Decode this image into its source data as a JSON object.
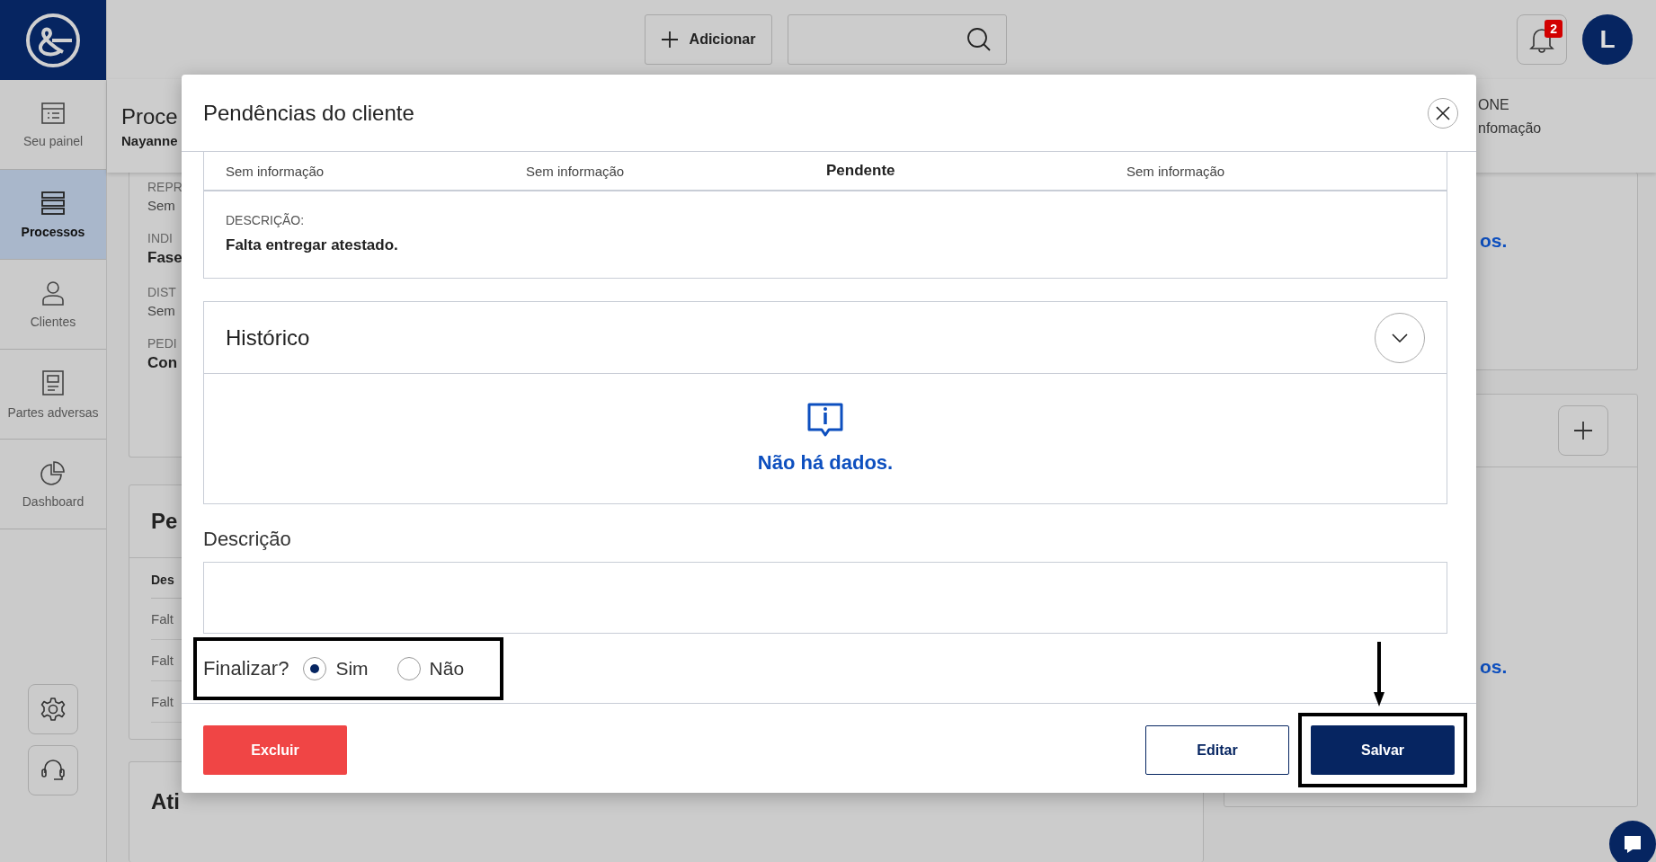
{
  "sidebar": {
    "items": [
      {
        "label": "Seu painel",
        "selected": false
      },
      {
        "label": "Processos",
        "selected": true
      },
      {
        "label": "Clientes",
        "selected": false
      },
      {
        "label": "Partes adversas",
        "selected": false
      },
      {
        "label": "Dashboard",
        "selected": false
      }
    ]
  },
  "topbar": {
    "add_button": "Adicionar",
    "notification_count": "2",
    "avatar_initial": "L"
  },
  "background": {
    "header": {
      "title": "Proce",
      "subtitle": "Nayanne",
      "right_label": "ONE",
      "right_value": "nfomação"
    },
    "details": [
      {
        "label": "REPR",
        "value": "Sem",
        "kind": "plain"
      },
      {
        "label": "INDI",
        "value": "Fase",
        "kind": "strong"
      },
      {
        "label": "DIST",
        "value": "Sem",
        "kind": "plain"
      },
      {
        "label": "PEDI",
        "value": "Con",
        "kind": "strong"
      }
    ],
    "pending_card": {
      "title": "Pe",
      "column": "Des",
      "rows": [
        "Falt",
        "Falt",
        "Falt"
      ]
    },
    "activities_card": {
      "title": "Ati"
    },
    "right_cards": [
      {
        "text": "os.",
        "kind": "plain"
      },
      {
        "text": "os.",
        "kind": "with_add"
      }
    ]
  },
  "modal": {
    "title": "Pendências do cliente",
    "summary": [
      {
        "text": "Sem informação",
        "kind": "plain"
      },
      {
        "text": "Sem informação",
        "kind": "plain"
      },
      {
        "text": "Pendente",
        "kind": "status"
      },
      {
        "text": "Sem informação",
        "kind": "plain"
      }
    ],
    "description": {
      "label": "DESCRIÇÃO:",
      "text": "Falta entregar atestado."
    },
    "history": {
      "title": "Histórico",
      "empty_text": "Não há dados."
    },
    "note_field": {
      "label": "Descrição"
    },
    "finalize": {
      "label": "Finalizar?",
      "options": [
        {
          "label": "Sim",
          "selected": true
        },
        {
          "label": "Não",
          "selected": false
        }
      ]
    },
    "buttons": [
      {
        "label": "Excluir",
        "kind": "danger"
      },
      {
        "label": "Editar",
        "kind": "secondary"
      },
      {
        "label": "Salvar",
        "kind": "primary"
      }
    ]
  }
}
